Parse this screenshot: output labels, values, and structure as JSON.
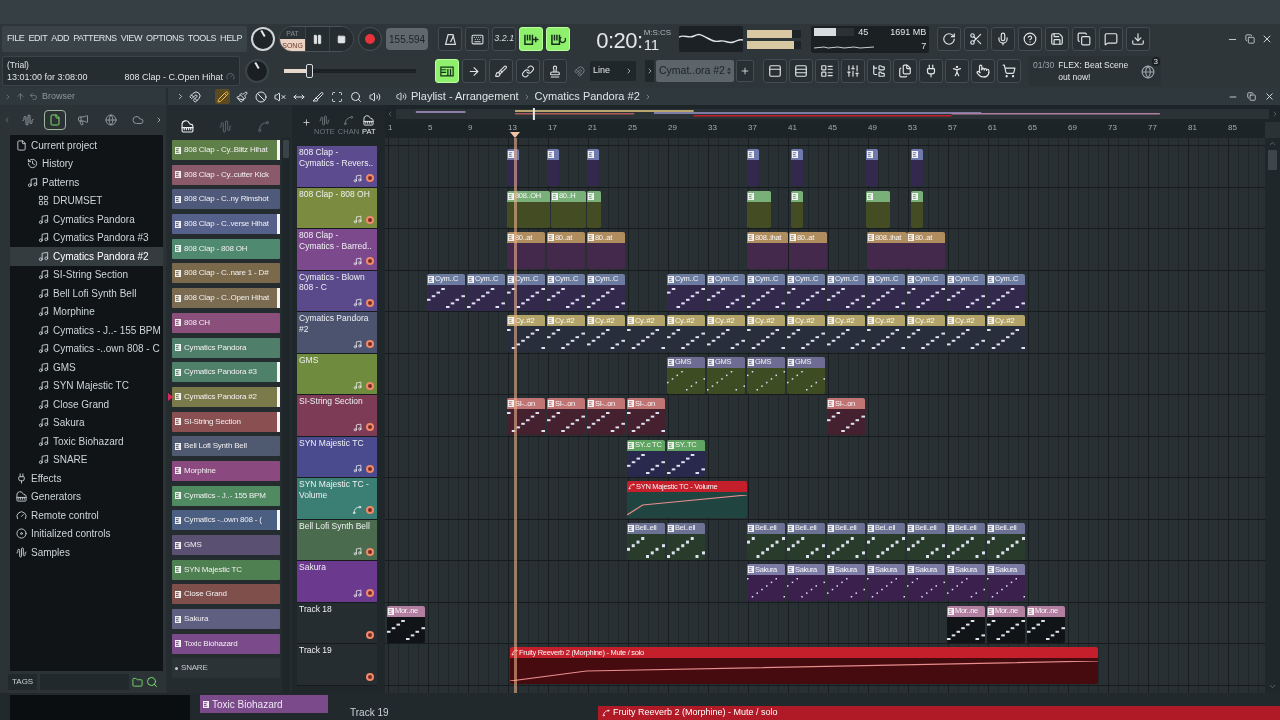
{
  "menu": [
    "FILE",
    "EDIT",
    "ADD",
    "PATTERNS",
    "VIEW",
    "OPTIONS",
    "TOOLS",
    "HELP"
  ],
  "hint_panel": {
    "title": "(Trial)",
    "line": "13:01:00 for 3:08:00",
    "hint": "808 Clap - C.Open Hihat"
  },
  "transport": {
    "modes": [
      {
        "label": "PAT",
        "selected": false
      },
      {
        "label": "SONG",
        "selected": true
      }
    ]
  },
  "tempo": "155.594",
  "toggles": [
    {
      "kind": "metronome",
      "on": false
    },
    {
      "kind": "wait",
      "on": false
    },
    {
      "kind": "countdown",
      "label": "3.2.1",
      "on": false
    },
    {
      "kind": "step",
      "on": true
    },
    {
      "kind": "loop",
      "on": true
    }
  ],
  "time": {
    "main": "0:20:",
    "format": "M:S:CS",
    "cs": "11"
  },
  "master_meter": [
    {
      "level": 0.83
    },
    {
      "level": 0.86
    }
  ],
  "performance": {
    "meter": {
      "level": 0.55
    },
    "cpu": "45",
    "memory": "1691 MB",
    "polyphony": "7"
  },
  "main_slider": {
    "level": 0.19
  },
  "edit_buttons": [
    {
      "kind": "pattern_song",
      "on": true
    },
    {
      "kind": "arrow",
      "on": false
    },
    {
      "kind": "brush",
      "on": false
    },
    {
      "kind": "link",
      "on": false
    },
    {
      "kind": "stamp",
      "on": false
    }
  ],
  "snap": "Line",
  "pattern_selector": "Cymat..ora #2",
  "news": {
    "counter": "01/30",
    "text": "FLEX: Beat Scene out now!",
    "badge": "3"
  },
  "browser": {
    "title": "Browser",
    "tabs": [
      {
        "kind": "waveform",
        "selected": false
      },
      {
        "kind": "files",
        "selected": true
      },
      {
        "kind": "speaker",
        "selected": false
      },
      {
        "kind": "globe",
        "selected": false
      },
      {
        "kind": "cloud",
        "selected": false
      }
    ],
    "tree": [
      {
        "label": "Current project",
        "kind": "project",
        "selected": false,
        "children": [
          {
            "label": "History",
            "kind": "history",
            "selected": false
          },
          {
            "label": "Patterns",
            "kind": "patterns",
            "selected": false,
            "children": [
              {
                "label": "DRUMSET",
                "kind": "drumset",
                "selected": false
              },
              {
                "label": "Cymatics Pandora",
                "kind": "pattern",
                "selected": false
              },
              {
                "label": "Cymatics Pandora #3",
                "kind": "pattern",
                "selected": false
              },
              {
                "label": "Cymatics Pandora #2",
                "kind": "pattern",
                "selected": true
              },
              {
                "label": "SI-String Section",
                "kind": "pattern",
                "selected": false
              },
              {
                "label": "Bell Lofi Synth Bell",
                "kind": "pattern",
                "selected": false
              },
              {
                "label": "Morphine",
                "kind": "pattern",
                "selected": false
              },
              {
                "label": "Cymatics - J..- 155 BPM",
                "kind": "pattern",
                "selected": false
              },
              {
                "label": "Cymatics -..own 808 - C",
                "kind": "pattern",
                "selected": false
              },
              {
                "label": "GMS",
                "kind": "pattern",
                "selected": false
              },
              {
                "label": "SYN Majestic TC",
                "kind": "pattern",
                "selected": false
              },
              {
                "label": "Close Grand",
                "kind": "pattern",
                "selected": false
              },
              {
                "label": "Sakura",
                "kind": "pattern",
                "selected": false
              },
              {
                "label": "Toxic Biohazard",
                "kind": "pattern",
                "selected": false
              },
              {
                "label": "SNARE",
                "kind": "pattern",
                "selected": false
              }
            ]
          }
        ]
      },
      {
        "label": "Effects",
        "kind": "effects",
        "selected": false
      },
      {
        "label": "Generators",
        "kind": "generators",
        "selected": false
      },
      {
        "label": "Remote control",
        "kind": "remote",
        "selected": false
      },
      {
        "label": "Initialized controls",
        "kind": "initialized",
        "selected": false
      },
      {
        "label": "Samples",
        "kind": "samples",
        "selected": false
      }
    ],
    "tags_label": "TAGS"
  },
  "playlist": {
    "title": "Playlist - Arrangement",
    "pattern": "Cymatics Pandora #2",
    "tools": [
      {
        "kind": "pencil",
        "selected": true
      },
      {
        "kind": "brush",
        "selected": false
      },
      {
        "kind": "delete",
        "selected": false
      },
      {
        "kind": "mute",
        "selected": false
      },
      {
        "kind": "slip",
        "selected": false
      },
      {
        "kind": "slice",
        "selected": false
      },
      {
        "kind": "select",
        "selected": false
      },
      {
        "kind": "zoom",
        "selected": false
      },
      {
        "kind": "playback",
        "selected": false
      }
    ],
    "picker_tabs": [
      {
        "kind": "patterns",
        "selected": true
      },
      {
        "kind": "audio",
        "selected": false
      },
      {
        "kind": "automation",
        "selected": false
      }
    ],
    "filters": [
      {
        "label": "NOTE",
        "selected": false
      },
      {
        "label": "CHAN",
        "selected": false
      },
      {
        "label": "PAT",
        "selected": true
      }
    ],
    "ruler": [
      "1",
      "5",
      "9",
      "13",
      "17",
      "21",
      "25",
      "29",
      "33",
      "37",
      "41",
      "45",
      "49",
      "53",
      "57",
      "61",
      "65",
      "69",
      "73",
      "77",
      "81",
      "85"
    ],
    "playhead": {
      "level": 0.148
    },
    "pattern_list": [
      {
        "kind": "pattern",
        "label": "808 Clap - Cy..Blitz Hihat",
        "color": "#5f7f49",
        "selected": false,
        "marked": true
      },
      {
        "kind": "pattern",
        "label": "808 Clap - Cy..cutter Kick",
        "color": "#8a5a6b",
        "selected": false,
        "marked": false
      },
      {
        "kind": "pattern",
        "label": "808 Clap - C..ny Rimshot",
        "color": "#4f5a7b",
        "selected": false,
        "marked": false
      },
      {
        "kind": "pattern",
        "label": "808 Clap - C..verse Hihat",
        "color": "#55608b",
        "selected": false,
        "marked": true
      },
      {
        "kind": "pattern",
        "label": "808 Clap - 808 OH",
        "color": "#4f8a70",
        "selected": false,
        "marked": false
      },
      {
        "kind": "pattern",
        "label": "808 Clap - C..nare 1 - D#",
        "color": "#7a6a4b",
        "selected": false,
        "marked": false
      },
      {
        "kind": "pattern",
        "label": "808 Clap - C..Open Hihat",
        "color": "#7b6b50",
        "selected": false,
        "marked": true
      },
      {
        "kind": "pattern",
        "label": "808 CH",
        "color": "#8a4f7b",
        "selected": false,
        "marked": false
      },
      {
        "kind": "pattern",
        "label": "Cymatics Pandora",
        "color": "#4f7f6b",
        "selected": false,
        "marked": false
      },
      {
        "kind": "pattern",
        "label": "Cymatics Pandora #3",
        "color": "#4f806a",
        "selected": false,
        "marked": true
      },
      {
        "kind": "pattern",
        "label": "Cymatics Pandora #2",
        "color": "#7b7a4a",
        "selected": true,
        "marked": true
      },
      {
        "kind": "pattern",
        "label": "SI-String Section",
        "color": "#8a5051",
        "selected": false,
        "marked": true
      },
      {
        "kind": "pattern",
        "label": "Bell Lofi Synth Bell",
        "color": "#4f5a71",
        "selected": false,
        "marked": false
      },
      {
        "kind": "pattern",
        "label": "Morphine",
        "color": "#8a4a80",
        "selected": false,
        "marked": false
      },
      {
        "kind": "pattern",
        "label": "Cymatics - J..- 155 BPM",
        "color": "#4f8a60",
        "selected": false,
        "marked": false
      },
      {
        "kind": "pattern",
        "label": "Cymatics -..own 808 - (",
        "color": "#4a5f81",
        "selected": false,
        "marked": true
      },
      {
        "kind": "pattern",
        "label": "GMS",
        "color": "#5a5071",
        "selected": false,
        "marked": false
      },
      {
        "kind": "pattern",
        "label": "SYN Majestic TC",
        "color": "#4f8051",
        "selected": false,
        "marked": false
      },
      {
        "kind": "pattern",
        "label": "Close Grand",
        "color": "#7f4f4b",
        "selected": false,
        "marked": false
      },
      {
        "kind": "pattern",
        "label": "Sakura",
        "color": "#5f5f81",
        "selected": false,
        "marked": false
      },
      {
        "kind": "pattern",
        "label": "Toxic Biohazard",
        "color": "#7a4a8b",
        "selected": false,
        "marked": false
      },
      {
        "kind": "empty",
        "label": "SNARE",
        "selected": false,
        "marked": false
      }
    ],
    "tracks": [
      {
        "name": "808 Clap - Cymatics - Revers..",
        "kind": "pattern",
        "color": "#5c4b8e",
        "muted": false,
        "clips": [
          {
            "kind": "pattern",
            "color": "#6f79ad"
          },
          {
            "kind": "pattern",
            "color": "#6f79ad"
          },
          {
            "kind": "pattern",
            "color": "#6f79ad"
          },
          {
            "kind": "pattern",
            "color": "#6f79ad"
          },
          {
            "kind": "pattern",
            "color": "#6f79ad"
          },
          {
            "kind": "pattern",
            "color": "#6f79ad"
          },
          {
            "kind": "pattern",
            "color": "#6f79ad"
          }
        ]
      },
      {
        "name": "808 Clap - 808 OH",
        "kind": "pattern",
        "color": "#7b8b3f",
        "muted": false,
        "clips": [
          {
            "kind": "pattern",
            "label": "808..OH",
            "color": "#79b07a"
          },
          {
            "kind": "pattern",
            "label": "80..H",
            "color": "#79b07a"
          },
          {
            "kind": "pattern",
            "color": "#79b07a"
          },
          {
            "kind": "pattern",
            "color": "#79b07a"
          },
          {
            "kind": "pattern",
            "color": "#79b07a"
          },
          {
            "kind": "pattern",
            "color": "#79b07a"
          },
          {
            "kind": "pattern",
            "color": "#79b07a"
          }
        ]
      },
      {
        "name": "808 Clap - Cymatics - Barred..",
        "kind": "pattern",
        "color": "#7c4a8c",
        "muted": false,
        "clips": [
          {
            "kind": "pattern",
            "label": "80..at",
            "color": "#b08d5e"
          },
          {
            "kind": "pattern",
            "label": "80..at",
            "color": "#b08d5e"
          },
          {
            "kind": "pattern",
            "label": "80..at",
            "color": "#b08d5e"
          },
          {
            "kind": "pattern",
            "label": "808..ihat",
            "color": "#b08d5e"
          },
          {
            "kind": "pattern",
            "label": "80..at",
            "color": "#b08d5e"
          },
          {
            "kind": "pattern",
            "label": "808..ihat",
            "color": "#b08d5e"
          },
          {
            "kind": "pattern",
            "label": "80..at",
            "color": "#b08d5e"
          }
        ]
      },
      {
        "name": "Cymatics - Blown 808 - C",
        "kind": "pattern",
        "color": "#5a4a8c",
        "muted": false,
        "clips": [
          {
            "kind": "pattern",
            "label": "Cym..C",
            "color": "#6c7ba0"
          },
          {
            "kind": "pattern",
            "label": "Cym..C",
            "color": "#6c7ba0"
          },
          {
            "kind": "pattern",
            "label": "Cym..C",
            "color": "#6c7ba0"
          },
          {
            "kind": "pattern",
            "label": "Cym..C",
            "color": "#6c7ba0"
          },
          {
            "kind": "pattern",
            "label": "Cym..C",
            "color": "#6c7ba0"
          },
          {
            "kind": "pattern",
            "label": "Cym..C",
            "color": "#6c7ba0"
          },
          {
            "kind": "pattern",
            "label": "Cym..C",
            "color": "#6c7ba0"
          },
          {
            "kind": "pattern",
            "label": "Cym..C",
            "color": "#6c7ba0"
          },
          {
            "kind": "pattern",
            "label": "Cym..C",
            "color": "#6c7ba0"
          },
          {
            "kind": "pattern",
            "label": "Cym..C",
            "color": "#6c7ba0"
          },
          {
            "kind": "pattern",
            "label": "Cym..C",
            "color": "#6c7ba0"
          },
          {
            "kind": "pattern",
            "label": "Cym..C",
            "color": "#6c7ba0"
          },
          {
            "kind": "pattern",
            "label": "Cym..C",
            "color": "#6c7ba0"
          },
          {
            "kind": "pattern",
            "label": "Cym..C",
            "color": "#6c7ba0"
          }
        ]
      },
      {
        "name": "Cymatics Pandora #2",
        "kind": "pattern",
        "color": "#4b536f",
        "muted": false,
        "clips": [
          {
            "kind": "pattern",
            "label": "Cy..#2",
            "color": "#b2a468"
          },
          {
            "kind": "pattern",
            "label": "Cy..#2",
            "color": "#b2a468"
          },
          {
            "kind": "pattern",
            "label": "Cy..#2",
            "color": "#b2a468"
          },
          {
            "kind": "pattern",
            "label": "Cy..#2",
            "color": "#b2a468"
          },
          {
            "kind": "pattern",
            "label": "Cy..#2",
            "color": "#b2a468"
          },
          {
            "kind": "pattern",
            "label": "Cy..#2",
            "color": "#b2a468"
          },
          {
            "kind": "pattern",
            "label": "Cy..#2",
            "color": "#b2a468"
          },
          {
            "kind": "pattern",
            "label": "Cy..#2",
            "color": "#b2a468"
          },
          {
            "kind": "pattern",
            "label": "Cy..#2",
            "color": "#b2a468"
          },
          {
            "kind": "pattern",
            "label": "Cy..#2",
            "color": "#b2a468"
          },
          {
            "kind": "pattern",
            "label": "Cy..#2",
            "color": "#b2a468"
          },
          {
            "kind": "pattern",
            "label": "Cy..#2",
            "color": "#b2a468"
          },
          {
            "kind": "pattern",
            "label": "Cy..#2",
            "color": "#b2a468"
          }
        ]
      },
      {
        "name": "GMS",
        "kind": "pattern",
        "color": "#6f8b3e",
        "muted": false,
        "clips": [
          {
            "kind": "pattern",
            "label": "GMS",
            "color": "#6e6c92"
          },
          {
            "kind": "pattern",
            "label": "GMS",
            "color": "#6e6c92"
          },
          {
            "kind": "pattern",
            "label": "GMS",
            "color": "#6e6c92"
          },
          {
            "kind": "pattern",
            "label": "GMS",
            "color": "#6e6c92"
          }
        ]
      },
      {
        "name": "SI-String Section",
        "kind": "pattern",
        "color": "#7d3b56",
        "muted": false,
        "clips": [
          {
            "kind": "pattern",
            "label": "SI-..on",
            "color": "#c07474"
          },
          {
            "kind": "pattern",
            "label": "SI-..on",
            "color": "#c07474"
          },
          {
            "kind": "pattern",
            "label": "SI-..on",
            "color": "#c07474"
          },
          {
            "kind": "pattern",
            "label": "SI-..on",
            "color": "#c07474"
          },
          {
            "kind": "pattern",
            "label": "SI-..on",
            "color": "#c07474"
          }
        ]
      },
      {
        "name": "SYN Majestic TC",
        "kind": "pattern",
        "color": "#4a4a8e",
        "muted": false,
        "clips": [
          {
            "kind": "pattern",
            "label": "SY..c TC",
            "color": "#5fa561"
          },
          {
            "kind": "pattern",
            "label": "SY..TC",
            "color": "#5fa561"
          }
        ]
      },
      {
        "name": "SYN Majestic TC - Volume",
        "kind": "automation",
        "color": "#3a7e74",
        "muted": false,
        "clips": [
          {
            "kind": "automation",
            "label": "SYN Majestic TC - Volume",
            "color": "#c41f2b"
          }
        ]
      },
      {
        "name": "Bell Lofi Synth Bell",
        "kind": "pattern",
        "color": "#4a6b4d",
        "muted": false,
        "clips": [
          {
            "kind": "pattern",
            "label": "Bell..ell",
            "color": "#6b7294"
          },
          {
            "kind": "pattern",
            "label": "Bel..ell",
            "color": "#6b7294"
          },
          {
            "kind": "pattern",
            "label": "Bell..ell",
            "color": "#6b7294"
          },
          {
            "kind": "pattern",
            "label": "Bell..ell",
            "color": "#6b7294"
          },
          {
            "kind": "pattern",
            "label": "Bell..ell",
            "color": "#6b7294"
          },
          {
            "kind": "pattern",
            "label": "Bel..ell",
            "color": "#6b7294"
          },
          {
            "kind": "pattern",
            "label": "Bell..ell",
            "color": "#6b7294"
          },
          {
            "kind": "pattern",
            "label": "Bell..ell",
            "color": "#6b7294"
          },
          {
            "kind": "pattern",
            "label": "Bell..ell",
            "color": "#6b7294"
          }
        ]
      },
      {
        "name": "Sakura",
        "kind": "pattern",
        "color": "#6b3a8e",
        "muted": false,
        "clips": [
          {
            "kind": "pattern",
            "label": "Sakura",
            "color": "#7d7ca6"
          },
          {
            "kind": "pattern",
            "label": "Sakura",
            "color": "#7d7ca6"
          },
          {
            "kind": "pattern",
            "label": "Sakura",
            "color": "#7d7ca6"
          },
          {
            "kind": "pattern",
            "label": "Sakura",
            "color": "#7d7ca6"
          },
          {
            "kind": "pattern",
            "label": "Sakura",
            "color": "#7d7ca6"
          },
          {
            "kind": "pattern",
            "label": "Sakura",
            "color": "#7d7ca6"
          },
          {
            "kind": "pattern",
            "label": "Sakura",
            "color": "#7d7ca6"
          }
        ]
      },
      {
        "name": "Track 18",
        "kind": "empty",
        "muted": false,
        "clips": [
          {
            "kind": "pattern",
            "label": "Mor..ne",
            "color": "#b27fa0"
          },
          {
            "kind": "pattern",
            "label": "Mor..ne",
            "color": "#b27fa0"
          },
          {
            "kind": "pattern",
            "label": "Mor..ne",
            "color": "#b27fa0"
          },
          {
            "kind": "pattern",
            "label": "Mor..ne",
            "color": "#b27fa0"
          }
        ]
      },
      {
        "name": "Track 19",
        "kind": "empty",
        "muted": false,
        "clips": [
          {
            "kind": "automation",
            "label": "Fruity Reeverb 2 (Morphine) - Mute / solo",
            "color": "#c41f2b"
          }
        ]
      }
    ]
  },
  "background_layer": {
    "pattern": "Toxic Biohazard",
    "track": "Track 19",
    "automation": "Fruity Reeverb 2 (Morphine) - Mute / solo"
  }
}
